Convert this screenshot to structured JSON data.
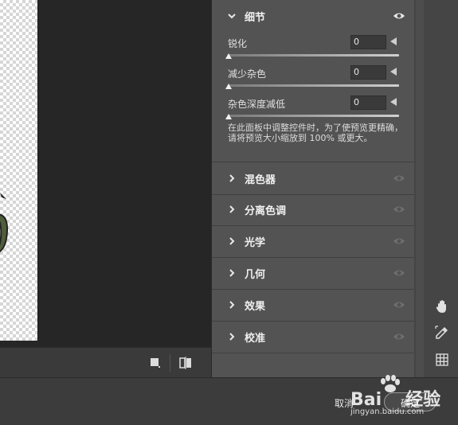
{
  "detail_section": {
    "title": "细节",
    "sliders": [
      {
        "label": "锐化",
        "value": "0"
      },
      {
        "label": "减少杂色",
        "value": "0"
      },
      {
        "label": "杂色深度减低",
        "value": "0"
      }
    ],
    "hint": "在此面板中调整控件时，为了使预览更精确，请将预览大小缩放到 100% 或更大。"
  },
  "sections": [
    {
      "title": "混色器"
    },
    {
      "title": "分离色调"
    },
    {
      "title": "光学"
    },
    {
      "title": "几何"
    },
    {
      "title": "效果"
    },
    {
      "title": "校准"
    }
  ],
  "buttons": {
    "cancel": "取消",
    "ok": "确定"
  },
  "tools": [
    "hand-icon",
    "color-sampler-icon",
    "grid-icon"
  ],
  "footer_icons": [
    "view-mode-icon",
    "before-after-icon"
  ],
  "watermark": {
    "brand": "Bai",
    "brand2": "经验",
    "url": "jingyan.baidu.com"
  }
}
